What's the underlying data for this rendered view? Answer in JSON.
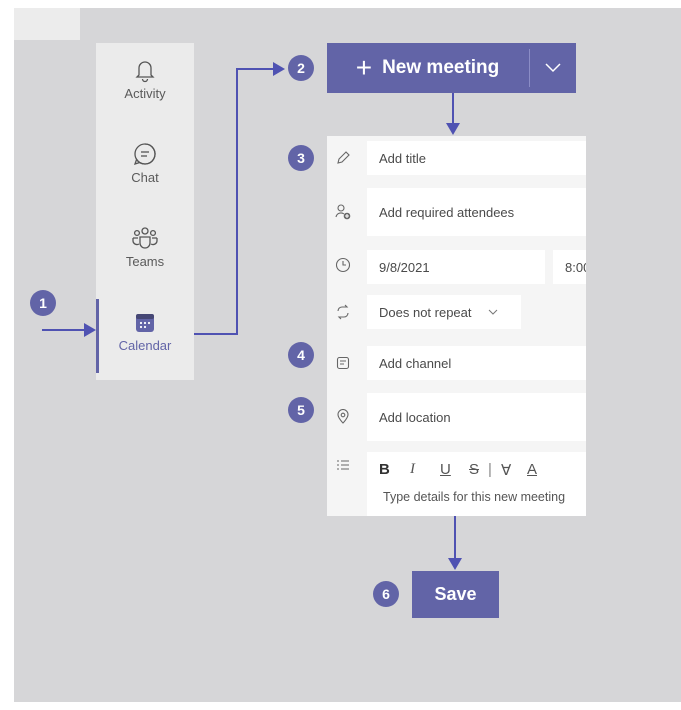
{
  "rail": {
    "items": [
      {
        "label": "Activity",
        "icon": "bell-icon"
      },
      {
        "label": "Chat",
        "icon": "chat-icon"
      },
      {
        "label": "Teams",
        "icon": "teams-icon"
      },
      {
        "label": "Calendar",
        "icon": "calendar-icon",
        "active": true
      }
    ]
  },
  "steps": [
    "1",
    "2",
    "3",
    "4",
    "5",
    "6"
  ],
  "new_meeting": {
    "label": "New meeting",
    "plus": "+"
  },
  "form": {
    "title_placeholder": "Add title",
    "attendees_placeholder": "Add required attendees",
    "date": "9/8/2021",
    "time": "8:00",
    "repeat": "Does not repeat",
    "channel_placeholder": "Add channel",
    "location_placeholder": "Add location",
    "toolbar": {
      "bold": "B",
      "italic": "I",
      "underline": "U",
      "strike": "S",
      "sep": "|",
      "highlight": "∀",
      "font_color": "A"
    },
    "details_placeholder": "Type details for this new meeting"
  },
  "save_label": "Save",
  "colors": {
    "accent": "#6264a7",
    "arrow": "#4f52b2",
    "background": "#d6d6d8"
  }
}
